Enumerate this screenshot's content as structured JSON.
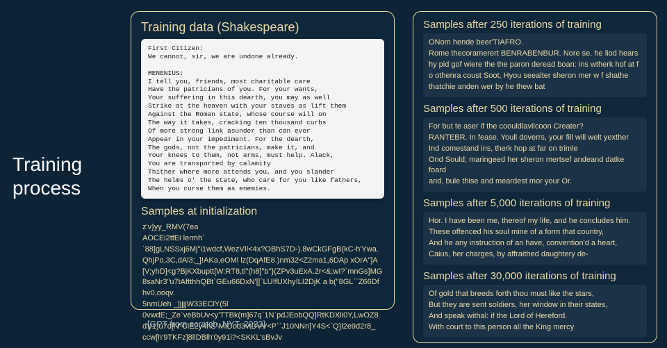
{
  "sideTitle": "Training\nprocess",
  "leftPanel": {
    "heading": "Training data (Shakespeare)",
    "trainingText": "First Citizen:\nWe cannot, sir, we are undone already.\n\nMENENIUS:\nI tell you, friends, most charitable care\nHave the patricians of you. For your wants,\nYour suffering in this dearth, you may as well\nStrike at the heaven with your staves as lift them\nAgainst the Roman state, whose course will on\nThe way it takes, cracking ten thousand curbs\nOf more strong link asunder than can ever\nAppear in your impediment. For the dearth,\nThe gods, not the patricians, make it, and\nYour knees to them, not arms, must help. Alack,\nYou are transported by calamity\nThither where more attends you, and you slander\nThe helms o' the state, who care for you like fathers,\nWhen you curse them as enemies.",
    "initHeading": "Samples at initialization",
    "initSample": "z'v}yy_RMV(7ea\nAOCEi2tfEi lermh`\n`88]gLNSSxj6Mj\"i1wdcf,WezVIl<4x?OBhS7D-).8wCkGFgB(kC-h'Ywa.QhjPo,3C,dAl3;_]!AKa,eOMl lz(DqAfE8.)nm32<Z2ma1,6DAp xOrA\"]A[V;yhD]<g?BjKXbuptt[W:RT8,tl\"(h8]\"b\"}(ZPv3uExA.2r<&;wI?`mnGs]MG8saNr3\"u7tAftthhQBt`GEu66DxN'[[`LU!fUXhy!LI2DjK a b(\"8GL``Z66Dfhv0,ooqv.\n5nmUeh _]jjjjW33EClY(5l\n0vwdE;_Ze`veBbUv<y'TTBk(m]67q`1N`pdJEobQQ]RtKDXii0Y,LwOZ8d'y1)u7d[N\"ClE2y4hS\"MIDod3vtDVV<P``J10NNn]Y4S<`Q}l2e9d2r8_\nccw[h'9TKFz]8llDBlh'0y91i?<SKKL'sBvJv"
  },
  "rightPanel": {
    "s250h": "Samples after 250 iterations of training",
    "s250": "ONom hende beer'TIAFRO.\nRome thecoramerert BENRABENBUR. Nore se. he liod hears hy pid gof wiere the the paron deread boan: ins wtherk hof at f o othenra coust Soot, Hyou seealter sheron mer w f shathe thatchie anden wer by he thew bat",
    "s500h": "Samples after 500 iterations of training",
    "s500": "For but te aser if the coouldlavilcoon Creater?\nRANTEBR. In fease. Youll doverrs, your fill will welt yexther\nInd comestand ins, therk hop at far on trimle\nOnd Sould; maringeed her sheron mertsef andeand datke foard\nand, bule thise and meardest mor your Or.",
    "s5000h": "Samples after 5,000 iterations of training",
    "s5000": "Hor. I have been me, thereof my life, and he concludes him.\nThese offenced his soul mine of a form that country,\nAnd he any instruction of an have, convention'd a heart,\nCaius, her charges, by affraithed daughtery de-",
    "s30000h": "Samples after 30,000 iterations of training",
    "s30000": "Of gold that breeds forth thou must like the stars,\nBut they are sent soldiers, her window in their states,\nAnd speak withal: if the Lord of Hereford.\nWith court to this person all the King mercy"
  },
  "citation": "[GPT from scratch, NYT, 2023]"
}
